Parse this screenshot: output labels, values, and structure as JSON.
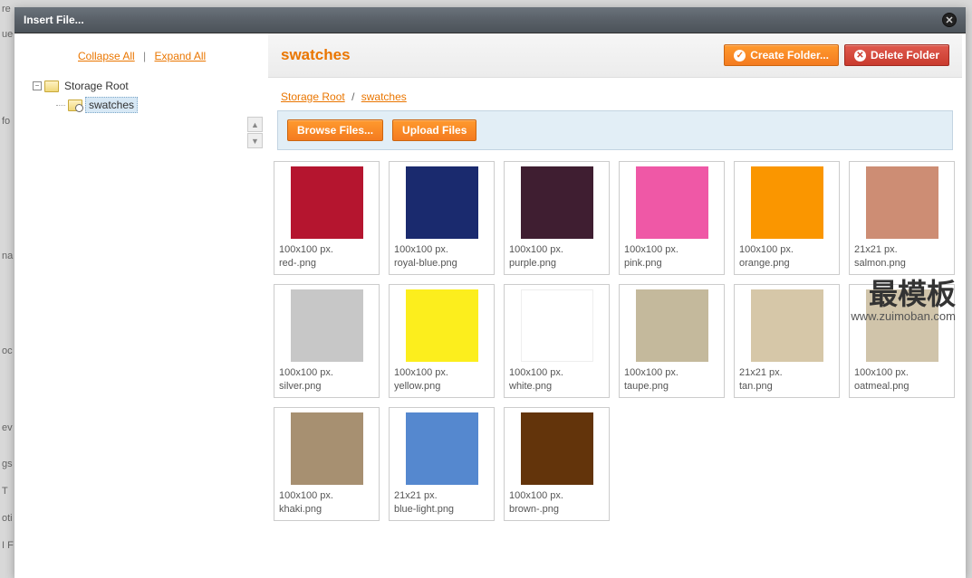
{
  "dialog_title": "Insert File...",
  "tree_actions": {
    "collapse": "Collapse All",
    "expand": "Expand All"
  },
  "tree": {
    "root": "Storage Root",
    "children": [
      {
        "label": "swatches",
        "selected": true
      }
    ]
  },
  "current_folder": "swatches",
  "breadcrumb": [
    {
      "label": "Storage Root"
    },
    {
      "label": "swatches"
    }
  ],
  "buttons": {
    "create_folder": "Create Folder...",
    "delete_folder": "Delete Folder",
    "browse_files": "Browse Files...",
    "upload_files": "Upload Files"
  },
  "files": [
    {
      "dim": "100x100 px.",
      "name": "red-.png",
      "color": "#b5152f"
    },
    {
      "dim": "100x100 px.",
      "name": "royal-blue.png",
      "color": "#1a2a6e"
    },
    {
      "dim": "100x100 px.",
      "name": "purple.png",
      "color": "#3f1e31"
    },
    {
      "dim": "100x100 px.",
      "name": "pink.png",
      "color": "#ef58a6"
    },
    {
      "dim": "100x100 px.",
      "name": "orange.png",
      "color": "#fa9600"
    },
    {
      "dim": "21x21 px.",
      "name": "salmon.png",
      "color": "#cd8d74"
    },
    {
      "dim": "100x100 px.",
      "name": "silver.png",
      "color": "#c7c7c7"
    },
    {
      "dim": "100x100 px.",
      "name": "yellow.png",
      "color": "#fcee1d"
    },
    {
      "dim": "100x100 px.",
      "name": "white.png",
      "color": "#ffffff"
    },
    {
      "dim": "100x100 px.",
      "name": "taupe.png",
      "color": "#c4b99c"
    },
    {
      "dim": "21x21 px.",
      "name": "tan.png",
      "color": "#d6c7a8"
    },
    {
      "dim": "100x100 px.",
      "name": "oatmeal.png",
      "color": "#d0c4aa"
    },
    {
      "dim": "100x100 px.",
      "name": "khaki.png",
      "color": "#a79071"
    },
    {
      "dim": "21x21 px.",
      "name": "blue-light.png",
      "color": "#5588cf"
    },
    {
      "dim": "100x100 px.",
      "name": "brown-.png",
      "color": "#63340b"
    }
  ],
  "watermark": {
    "main": "最模板",
    "sub": "www.zuimoban.com"
  }
}
